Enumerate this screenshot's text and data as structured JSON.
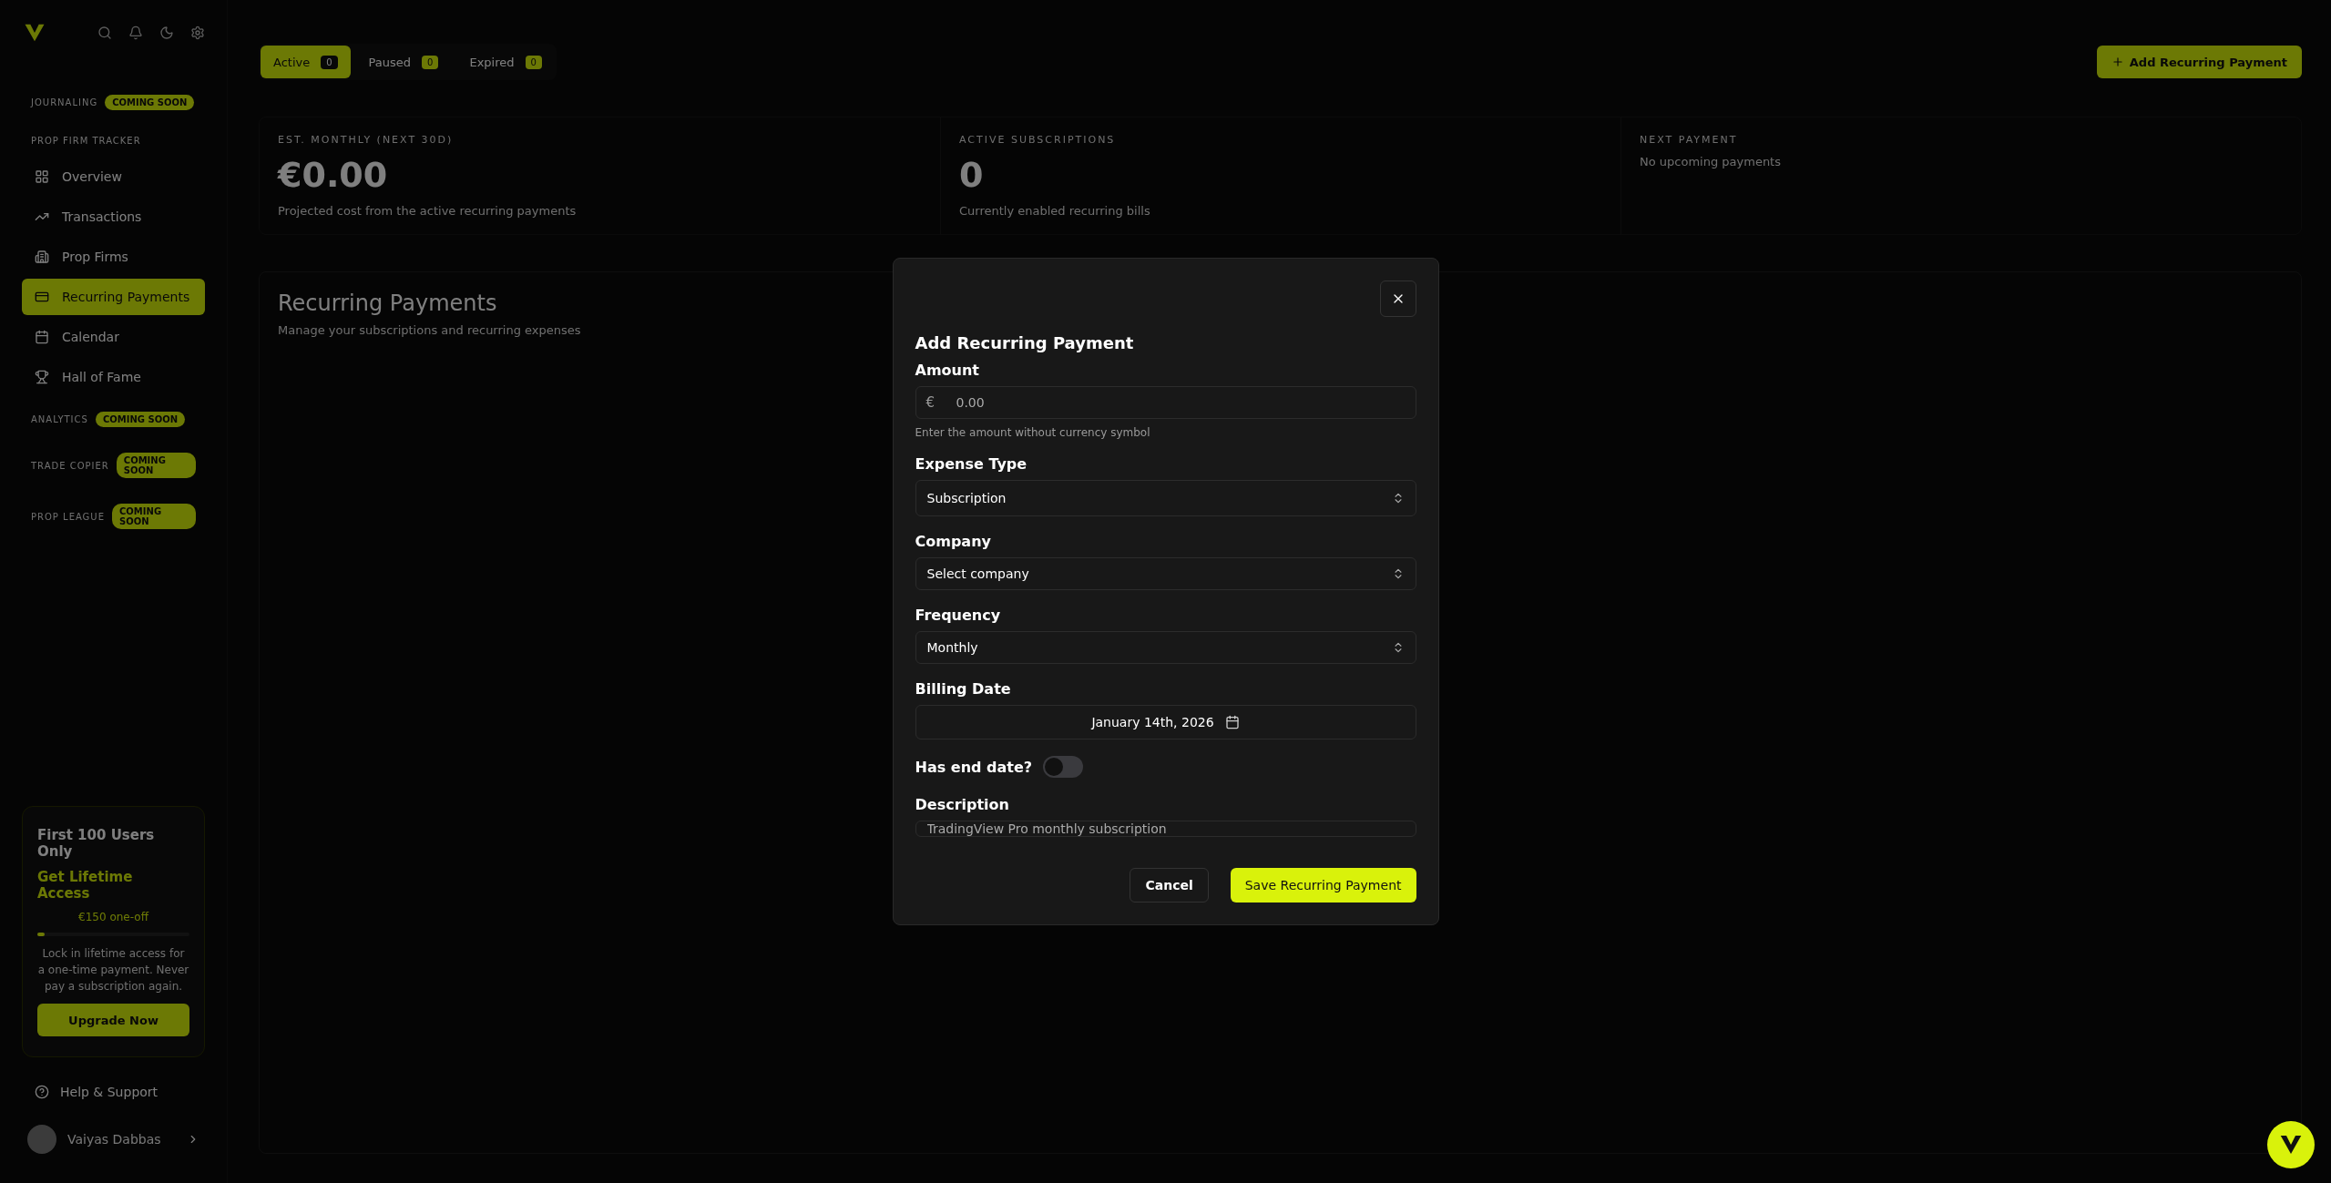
{
  "sidebar": {
    "sections": [
      {
        "title": "JOURNALING",
        "badge": "COMING SOON"
      },
      {
        "title": "PROP FIRM TRACKER",
        "items": [
          {
            "label": "Overview",
            "selected": false
          },
          {
            "label": "Transactions",
            "selected": false
          },
          {
            "label": "Prop Firms",
            "selected": false
          },
          {
            "label": "Recurring Payments",
            "selected": true
          },
          {
            "label": "Calendar",
            "selected": false
          },
          {
            "label": "Hall of Fame",
            "selected": false
          }
        ]
      },
      {
        "title": "ANALYTICS",
        "badge": "COMING SOON"
      },
      {
        "title": "TRADE COPIER",
        "badge": "COMING SOON"
      },
      {
        "title": "PROP LEAGUE",
        "badge": "COMING SOON"
      }
    ],
    "promo": {
      "title": "First 100 Users Only",
      "headline": "Get Lifetime Access",
      "price": "€150 one-off",
      "level": 0.05,
      "text": "Lock in lifetime access for a one-time payment. Never pay a subscription again.",
      "button": "Upgrade Now"
    },
    "help": "Help & Support",
    "user": {
      "name": "Vaiyas Dabbas"
    }
  },
  "tabs": [
    {
      "label": "Active",
      "count": "0",
      "selected": true
    },
    {
      "label": "Paused",
      "count": "0",
      "selected": false
    },
    {
      "label": "Expired",
      "count": "0",
      "selected": false
    }
  ],
  "add_button": "Add Recurring Payment",
  "stats": [
    {
      "label": "EST. MONTHLY (NEXT 30D)",
      "value": "€0.00",
      "note": "Projected cost from the active recurring payments"
    },
    {
      "label": "ACTIVE SUBSCRIPTIONS",
      "value": "0",
      "note": "Currently enabled recurring bills"
    },
    {
      "label": "NEXT PAYMENT",
      "note": "No upcoming payments"
    }
  ],
  "section": {
    "title": "Recurring Payments",
    "subtitle": "Manage your subscriptions and recurring expenses"
  },
  "dialog": {
    "title": "Add Recurring Payment",
    "fields": [
      {
        "kind": "amount",
        "label": "Amount",
        "prefix": "€",
        "placeholder": "0.00",
        "hint": "Enter the amount without currency symbol"
      },
      {
        "kind": "select",
        "label": "Expense Type",
        "value": "Subscription"
      },
      {
        "kind": "select",
        "label": "Company",
        "value": "Select company"
      },
      {
        "kind": "select",
        "label": "Frequency",
        "value": "Monthly"
      },
      {
        "kind": "date",
        "label": "Billing Date",
        "value": "January 14th, 2026"
      },
      {
        "kind": "toggle",
        "label": "Has end date?",
        "on": false
      },
      {
        "kind": "text",
        "label": "Description",
        "placeholder": "TradingView Pro monthly subscription"
      }
    ],
    "cancel": "Cancel",
    "save": "Save Recurring Payment"
  }
}
